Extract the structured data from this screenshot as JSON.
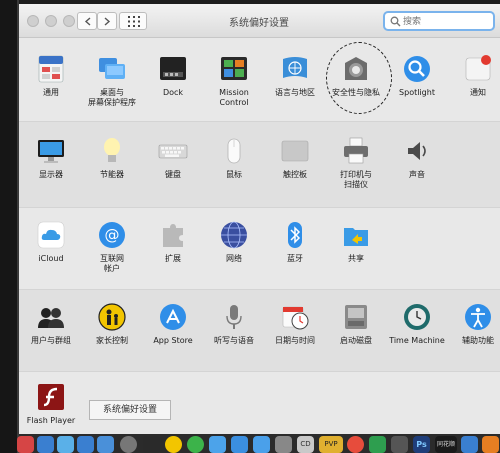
{
  "window": {
    "title": "系统偏好设置",
    "search_placeholder": "搜索"
  },
  "sections": [
    [
      {
        "label": "通用",
        "icon": "general-icon"
      },
      {
        "label": "桌面与\n屏幕保护程序",
        "icon": "desktop-screensaver-icon"
      },
      {
        "label": "Dock",
        "icon": "dock-icon"
      },
      {
        "label": "Mission\nControl",
        "icon": "mission-control-icon"
      },
      {
        "label": "语言与地区",
        "icon": "language-region-icon"
      },
      {
        "label": "安全性与隐私",
        "icon": "security-privacy-icon"
      },
      {
        "label": "Spotlight",
        "icon": "spotlight-icon"
      },
      {
        "label": "通知",
        "icon": "notifications-icon"
      }
    ],
    [
      {
        "label": "显示器",
        "icon": "displays-icon"
      },
      {
        "label": "节能器",
        "icon": "energy-saver-icon"
      },
      {
        "label": "键盘",
        "icon": "keyboard-icon"
      },
      {
        "label": "鼠标",
        "icon": "mouse-icon"
      },
      {
        "label": "触控板",
        "icon": "trackpad-icon"
      },
      {
        "label": "打印机与\n扫描仪",
        "icon": "printers-scanners-icon"
      },
      {
        "label": "声音",
        "icon": "sound-icon"
      }
    ],
    [
      {
        "label": "iCloud",
        "icon": "icloud-icon"
      },
      {
        "label": "互联网\n帐户",
        "icon": "internet-accounts-icon"
      },
      {
        "label": "扩展",
        "icon": "extensions-icon"
      },
      {
        "label": "网络",
        "icon": "network-icon"
      },
      {
        "label": "蓝牙",
        "icon": "bluetooth-icon"
      },
      {
        "label": "共享",
        "icon": "sharing-icon"
      }
    ],
    [
      {
        "label": "用户与群组",
        "icon": "users-groups-icon"
      },
      {
        "label": "家长控制",
        "icon": "parental-controls-icon"
      },
      {
        "label": "App Store",
        "icon": "app-store-icon"
      },
      {
        "label": "听写与语音",
        "icon": "dictation-speech-icon"
      },
      {
        "label": "日期与时间",
        "icon": "date-time-icon"
      },
      {
        "label": "启动磁盘",
        "icon": "startup-disk-icon"
      },
      {
        "label": "Time Machine",
        "icon": "time-machine-icon"
      },
      {
        "label": "辅助功能",
        "icon": "accessibility-icon"
      }
    ],
    [
      {
        "label": "Flash Player",
        "icon": "flash-player-icon"
      }
    ]
  ],
  "tooltip": "系统偏好设置",
  "dock": {
    "dock_icon_labels": [
      "CD",
      "PVP",
      "Ps",
      "同花顺"
    ]
  }
}
